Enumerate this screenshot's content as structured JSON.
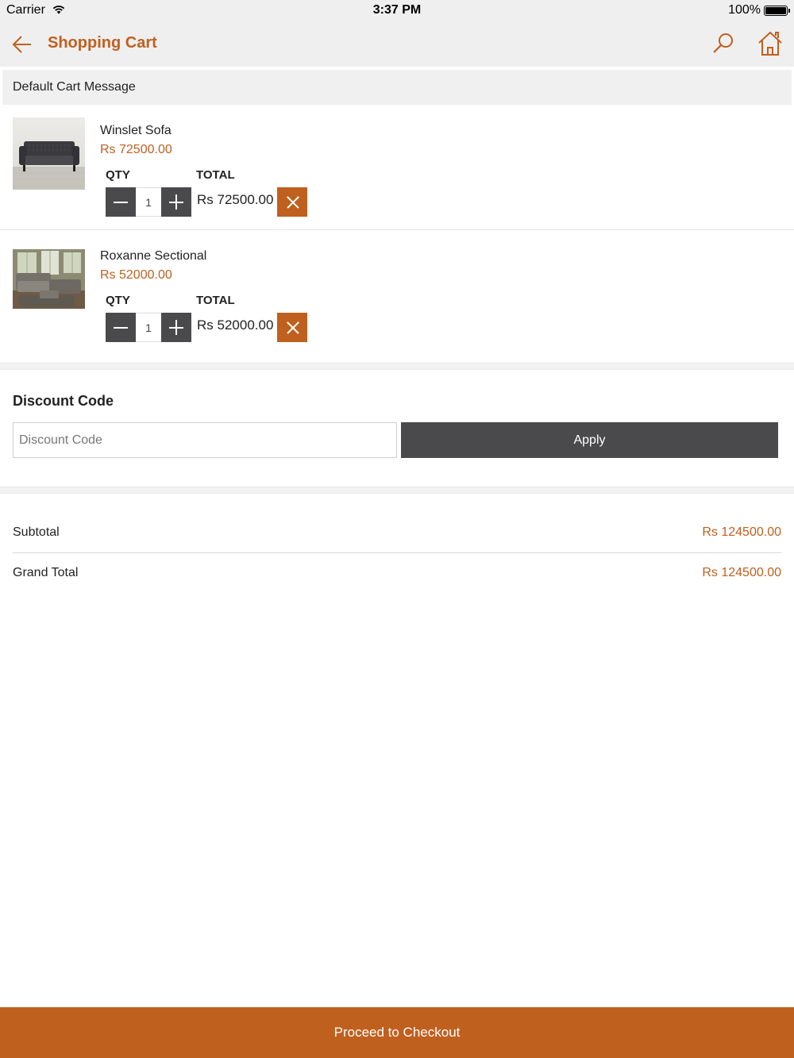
{
  "status_bar": {
    "carrier": "Carrier",
    "time": "3:37 PM",
    "battery": "100%"
  },
  "header": {
    "title": "Shopping Cart",
    "icons": {
      "back": "arrow-left-icon",
      "search": "search-icon",
      "home": "home-icon"
    }
  },
  "cart_message": "Default Cart Message",
  "cart": {
    "qty_label": "QTY",
    "total_label": "TOTAL",
    "items": [
      {
        "name": "Winslet Sofa",
        "price": "Rs 72500.00",
        "qty": "1",
        "total": "Rs 72500.00",
        "image": "sofa-photo"
      },
      {
        "name": "Roxanne Sectional",
        "price": "Rs 52000.00",
        "qty": "1",
        "total": "Rs 52000.00",
        "image": "sectional-sofa-photo"
      }
    ]
  },
  "discount": {
    "title": "Discount Code",
    "placeholder": "Discount Code",
    "value": "",
    "apply_label": "Apply"
  },
  "summary": {
    "subtotal_label": "Subtotal",
    "subtotal_value": "Rs 124500.00",
    "grand_total_label": "Grand Total",
    "grand_total_value": "Rs 124500.00"
  },
  "checkout_label": "Proceed to Checkout",
  "colors": {
    "accent": "#c0601f",
    "dark_button": "#4a4a4c",
    "bar_background": "#efefef"
  }
}
